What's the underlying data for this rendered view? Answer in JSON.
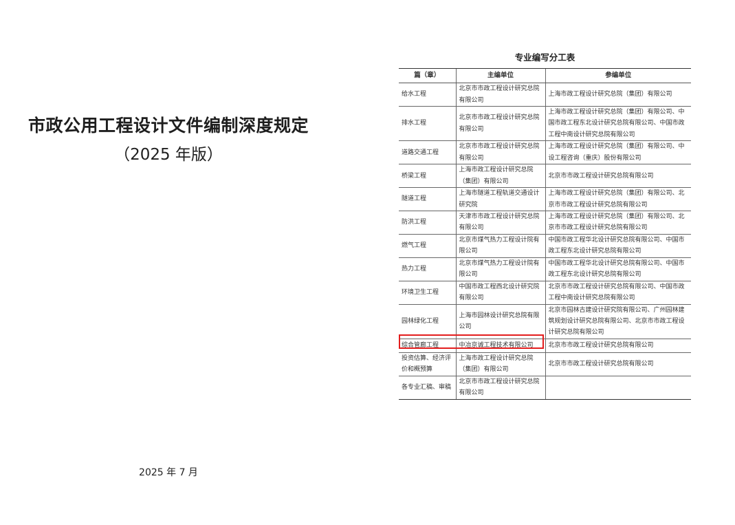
{
  "cover": {
    "title": "市政公用工程设计文件编制深度规定",
    "edition": "（2025 年版）",
    "date": "2025 年 7 月"
  },
  "table": {
    "title": "专业编写分工表",
    "headers": [
      "篇（章）",
      "主编单位",
      "参编单位"
    ],
    "rows": [
      {
        "chapter": "给水工程",
        "chief": "北京市市政工程设计研究总院有限公司",
        "participants": "上海市政工程设计研究总院（集团）有限公司"
      },
      {
        "chapter": "排水工程",
        "chief": "北京市市政工程设计研究总院有限公司",
        "participants": "上海市政工程设计研究总院（集团）有限公司、中国市政工程东北设计研究总院有限公司、中国市政工程中南设计研究总院有限公司"
      },
      {
        "chapter": "道路交通工程",
        "chief": "北京市市政工程设计研究总院有限公司",
        "participants": "上海市政工程设计研究总院（集团）有限公司、中设工程咨询（重庆）股份有限公司"
      },
      {
        "chapter": "桥梁工程",
        "chief": "上海市政工程设计研究总院（集团）有限公司",
        "participants": "北京市市政工程设计研究总院有限公司"
      },
      {
        "chapter": "隧道工程",
        "chief": "上海市隧道工程轨道交通设计研究院",
        "participants": "上海市政工程设计研究总院（集团）有限公司、北京市市政工程设计研究总院有限公司"
      },
      {
        "chapter": "防洪工程",
        "chief": "天津市市政工程设计研究总院有限公司",
        "participants": "上海市政工程设计研究总院（集团）有限公司、北京市市政工程设计研究总院有限公司"
      },
      {
        "chapter": "燃气工程",
        "chief": "北京市煤气热力工程设计院有限公司",
        "participants": "中国市政工程华北设计研究总院有限公司、中国市政工程东北设计研究总院有限公司"
      },
      {
        "chapter": "热力工程",
        "chief": "北京市煤气热力工程设计院有限公司",
        "participants": "中国市政工程华北设计研究总院有限公司、中国市政工程东北设计研究总院有限公司"
      },
      {
        "chapter": "环境卫生工程",
        "chief": "中国市政工程西北设计研究院有限公司",
        "participants": "北京市市政工程设计研究总院有限公司、中国市政工程中南设计研究总院有限公司"
      },
      {
        "chapter": "园林绿化工程",
        "chief": "上海市园林设计研究总院有限公司",
        "participants": "北京市园林古建设计研究院有限公司、广州园林建筑规划设计研究总院有限公司、北京市市政工程设计研究总院有限公司"
      },
      {
        "chapter": "综合管廊工程",
        "chief": "中冶京诚工程技术有限公司",
        "participants": "北京市市政工程设计研究总院有限公司"
      },
      {
        "chapter": "投资估算、经济评价和概预算",
        "chief": "上海市政工程设计研究总院（集团）有限公司",
        "participants": "北京市市政工程设计研究总院有限公司"
      },
      {
        "chapter": "各专业汇稿、审稿",
        "chief": "北京市市政工程设计研究总院有限公司",
        "participants": ""
      }
    ]
  },
  "highlight": {
    "row": "综合管廊工程",
    "color": "#e31d1d"
  }
}
